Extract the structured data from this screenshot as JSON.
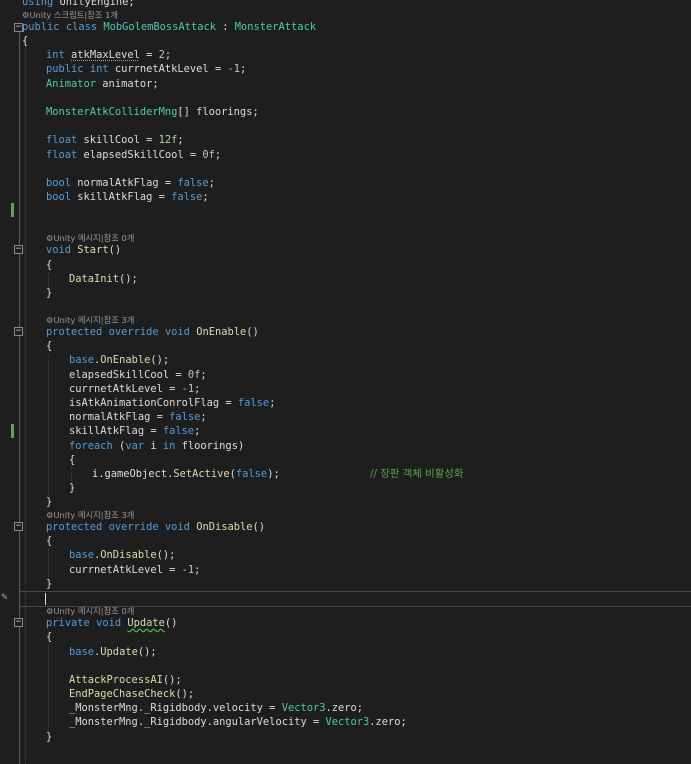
{
  "lines": {
    "l0": "using UnityEngine;",
    "l1": "public class MobGolemBossAttack : MonsterAttack",
    "l2": "{",
    "l3": "int atkMaxLevel = 2;",
    "l4": "public int currnetAtkLevel = -1;",
    "l5": "Animator animator;",
    "l6": "MonsterAtkColliderMng[] floorings;",
    "l7": "float skillCool = 12f;",
    "l8": "float elapsedSkillCool = 0f;",
    "l9": "bool normalAtkFlag = false;",
    "l10": "bool skillAtkFlag = false;",
    "l11": "void Start()",
    "l12": "{",
    "l13": "DataInit();",
    "l14": "}",
    "l15": "protected override void OnEnable()",
    "l16": "{",
    "l17": "base.OnEnable();",
    "l18": "elapsedSkillCool = 0f;",
    "l19": "currnetAtkLevel = -1;",
    "l20": "isAtkAnimationConrolFlag = false;",
    "l21": "normalAtkFlag = false;",
    "l22": "skillAtkFlag = false;",
    "l23": "foreach (var i in floorings)",
    "l24": "{",
    "l25": "i.gameObject.SetActive(false);",
    "l25c": "// 장판 객체 비활성화",
    "l26": "}",
    "l27": "}",
    "l28": "protected override void OnDisable()",
    "l29": "{",
    "l30": "base.OnDisable();",
    "l31": "currnetAtkLevel = -1;",
    "l32": "}",
    "l33": "private void Update()",
    "l34": "{",
    "l35": "base.Update();",
    "l36": "AttackProcessAI();",
    "l37": "EndPageChaseCheck();",
    "l38": "_MonsterMng._Rigidbody.velocity = Vector3.zero;",
    "l39": "_MonsterMng._Rigidbody.angularVelocity = Vector3.zero;",
    "l40": "}"
  },
  "codelens": {
    "class_lens": "Unity 스크립트|참조 1개",
    "start_lens": "Unity 메시지|참조 0개",
    "onenable_lens": "Unity 메시지|참조 3개",
    "ondisable_lens": "Unity 메시지|참조 3개",
    "update_lens": "Unity 메시지|참조 0개"
  },
  "icons": {
    "codelens": "gear-icon",
    "fold": "collapse-icon",
    "edit": "pencil-icon"
  },
  "colors": {
    "background": "#1e1e1e",
    "keyword": "#569cd6",
    "type": "#4ec9b0",
    "method": "#dcdcaa",
    "number": "#b5cea8",
    "comment": "#57a64a",
    "text": "#dcdcdc",
    "changed_margin": "#57a64a"
  }
}
